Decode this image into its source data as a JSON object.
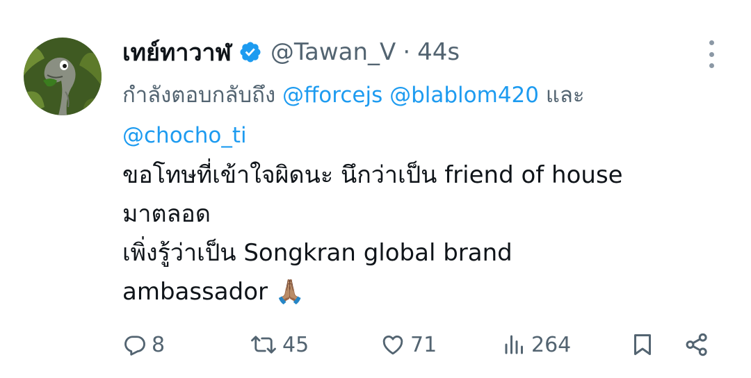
{
  "tweet": {
    "display_name": "เทย์ทาวาฬ",
    "handle": "@Tawan_V",
    "separator": "·",
    "time": "44s",
    "reply_prefix": "กำลังตอบกลับถึง",
    "mentions": [
      "@fforcejs",
      "@blablom420",
      "@chocho_ti"
    ],
    "mention_joiner": "และ",
    "body_lines": [
      "ขอโทษที่เข้าใจผิดนะ นึกว่าเป็น friend of house",
      "มาตลอด",
      "เพิ่งรู้ว่าเป็น Songkran global brand",
      "ambassador 🙏🏽"
    ],
    "avatar_icon": "cartoon-dinosaur-avatar",
    "verified_icon": "verified-badge-icon"
  },
  "actions": {
    "reply_count": "8",
    "retweet_count": "45",
    "like_count": "71",
    "views_count": "264"
  },
  "colors": {
    "text_primary": "#0f1419",
    "text_secondary": "#536471",
    "link": "#1d9bf0",
    "verified": "#1d9bf0"
  }
}
